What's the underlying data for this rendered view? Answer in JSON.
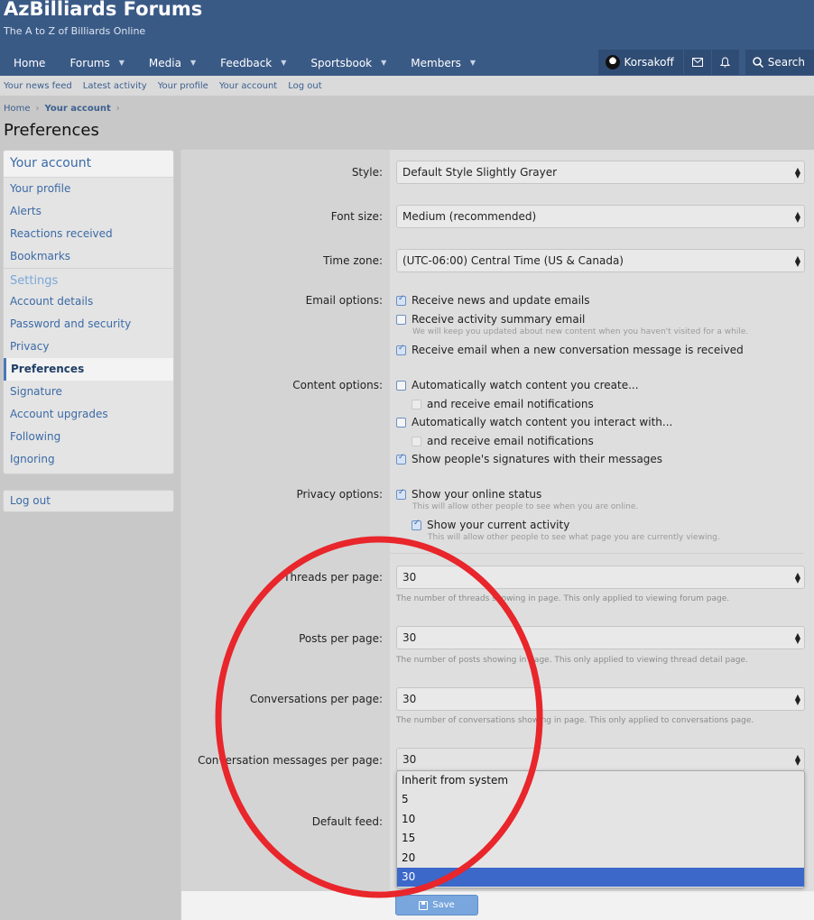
{
  "header": {
    "site_title": "AzBilliards Forums",
    "tagline": "The A to Z of Billiards Online",
    "nav": [
      {
        "label": "Home",
        "has_caret": false
      },
      {
        "label": "Forums",
        "has_caret": true
      },
      {
        "label": "Media",
        "has_caret": true
      },
      {
        "label": "Feedback",
        "has_caret": true
      },
      {
        "label": "Sportsbook",
        "has_caret": true
      },
      {
        "label": "Members",
        "has_caret": true
      }
    ],
    "user_name": "Korsakoff",
    "search_label": "Search",
    "icons": {
      "inbox": "envelope-icon",
      "alerts": "bell-icon",
      "search": "search-icon",
      "caret": "chevron-down-icon"
    }
  },
  "subnav": [
    "Your news feed",
    "Latest activity",
    "Your profile",
    "Your account",
    "Log out"
  ],
  "breadcrumb": {
    "home": "Home",
    "current": "Your account"
  },
  "page_title": "Preferences",
  "sidebar": {
    "heading": "Your account",
    "items_top": [
      "Your profile",
      "Alerts",
      "Reactions received",
      "Bookmarks"
    ],
    "settings_heading": "Settings",
    "items_settings": [
      "Account details",
      "Password and security",
      "Privacy",
      "Preferences",
      "Signature",
      "Account upgrades",
      "Following",
      "Ignoring"
    ],
    "active": "Preferences",
    "logout": "Log out"
  },
  "form": {
    "style": {
      "label": "Style:",
      "value": "Default Style Slightly Grayer"
    },
    "font_size": {
      "label": "Font size:",
      "value": "Medium (recommended)"
    },
    "time_zone": {
      "label": "Time zone:",
      "value": "(UTC-06:00) Central Time (US & Canada)"
    },
    "email_options": {
      "label": "Email options:",
      "receive_news": "Receive news and update emails",
      "receive_summary": "Receive activity summary email",
      "summary_hint": "We will keep you updated about new content when you haven't visited for a while.",
      "receive_conversation": "Receive email when a new conversation message is received"
    },
    "content_options": {
      "label": "Content options:",
      "watch_create": "Automatically watch content you create...",
      "watch_create_email": "and receive email notifications",
      "watch_interact": "Automatically watch content you interact with...",
      "watch_interact_email": "and receive email notifications",
      "show_signatures": "Show people's signatures with their messages"
    },
    "privacy_options": {
      "label": "Privacy options:",
      "online_status": "Show your online status",
      "online_hint": "This will allow other people to see when you are online.",
      "current_activity": "Show your current activity",
      "activity_hint": "This will allow other people to see what page you are currently viewing."
    },
    "threads_per_page": {
      "label": "Threads per page:",
      "value": "30",
      "desc": "The number of threads showing in page. This only applied to viewing forum page."
    },
    "posts_per_page": {
      "label": "Posts per page:",
      "value": "30",
      "desc": "The number of posts showing in page. This only applied to viewing thread detail page."
    },
    "conversations_per_page": {
      "label": "Conversations per page:",
      "value": "30",
      "desc": "The number of conversations showing in page. This only applied to conversations page."
    },
    "conversation_messages_per_page": {
      "label": "Conversation messages per page:",
      "value": "30",
      "options": [
        "Inherit from system",
        "5",
        "10",
        "15",
        "20",
        "30"
      ],
      "selected": "30"
    },
    "default_feed": {
      "label": "Default feed:"
    },
    "save_label": "Save"
  },
  "colors": {
    "header": "#3a5a86",
    "link": "#3b6aa6",
    "annotation": "#e8262b",
    "selected_option": "#3b68c9"
  }
}
